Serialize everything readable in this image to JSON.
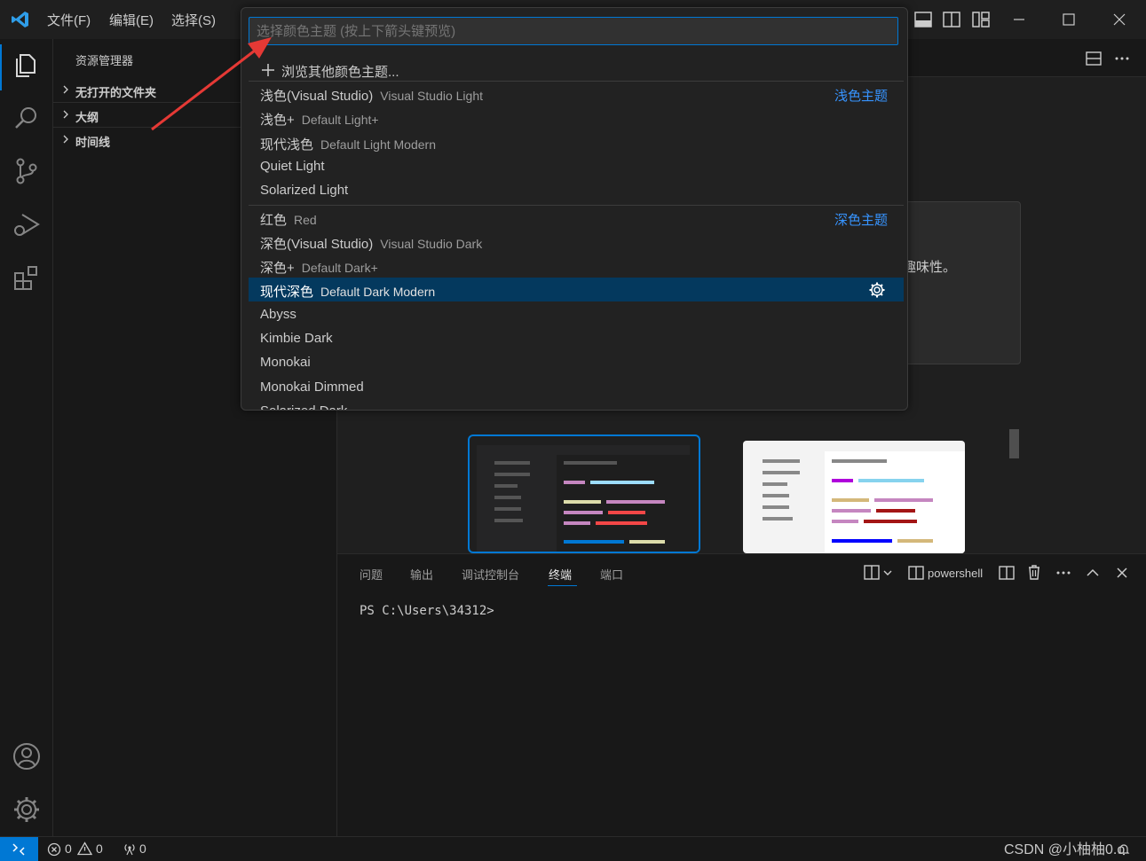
{
  "titlebar": {
    "menu": [
      "文件(F)",
      "编辑(E)",
      "选择(S)"
    ]
  },
  "sidebar": {
    "title": "资源管理器",
    "sections": [
      "无打开的文件夹",
      "大纲",
      "时间线"
    ]
  },
  "editor": {
    "partial_text": "趣味性。"
  },
  "quickpick": {
    "placeholder": "选择颜色主题 (按上下箭头键预览)",
    "browse": "浏览其他颜色主题...",
    "light_group": "浅色主题",
    "dark_group": "深色主题",
    "light_items": [
      {
        "label": "浅色(Visual Studio)",
        "desc": "Visual Studio Light"
      },
      {
        "label": "浅色+",
        "desc": "Default Light+"
      },
      {
        "label": "现代浅色",
        "desc": "Default Light Modern"
      },
      {
        "label": "Quiet Light",
        "desc": ""
      },
      {
        "label": "Solarized Light",
        "desc": ""
      }
    ],
    "dark_items": [
      {
        "label": "红色",
        "desc": "Red"
      },
      {
        "label": "深色(Visual Studio)",
        "desc": "Visual Studio Dark"
      },
      {
        "label": "深色+",
        "desc": "Default Dark+"
      },
      {
        "label": "现代深色",
        "desc": "Default Dark Modern"
      },
      {
        "label": "Abyss",
        "desc": ""
      },
      {
        "label": "Kimbie Dark",
        "desc": ""
      },
      {
        "label": "Monokai",
        "desc": ""
      },
      {
        "label": "Monokai Dimmed",
        "desc": ""
      },
      {
        "label": "Solarized Dark",
        "desc": ""
      }
    ],
    "selected_index": 3
  },
  "panel": {
    "tabs": [
      "问题",
      "输出",
      "调试控制台",
      "终端",
      "端口"
    ],
    "active_tab": "终端",
    "terminal_name": "powershell",
    "prompt": "PS C:\\Users\\34312>"
  },
  "statusbar": {
    "errors": "0",
    "warnings": "0",
    "ports": "0",
    "watermark": "CSDN @小柚柚0.o"
  },
  "colors": {
    "accent": "#0078d4",
    "selection": "#04395e",
    "group_label": "#3794ff",
    "annotation_arrow": "#e53935"
  }
}
